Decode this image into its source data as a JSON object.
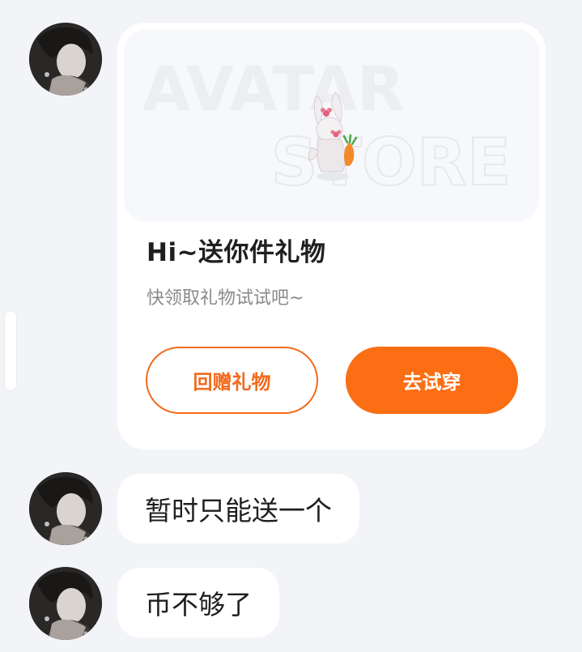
{
  "gift_card": {
    "banner_watermark_line1": "AVATAR",
    "banner_watermark_line2": "STORE",
    "title": "Hi~送你件礼物",
    "subtitle": "快领取礼物试试吧~",
    "return_gift_label": "回赠礼物",
    "try_on_label": "去试穿"
  },
  "messages": [
    {
      "text": "暂时只能送一个"
    },
    {
      "text": "币不够了"
    }
  ],
  "colors": {
    "accent_orange": "#fb6e14",
    "page_background": "#f3f4f8"
  }
}
